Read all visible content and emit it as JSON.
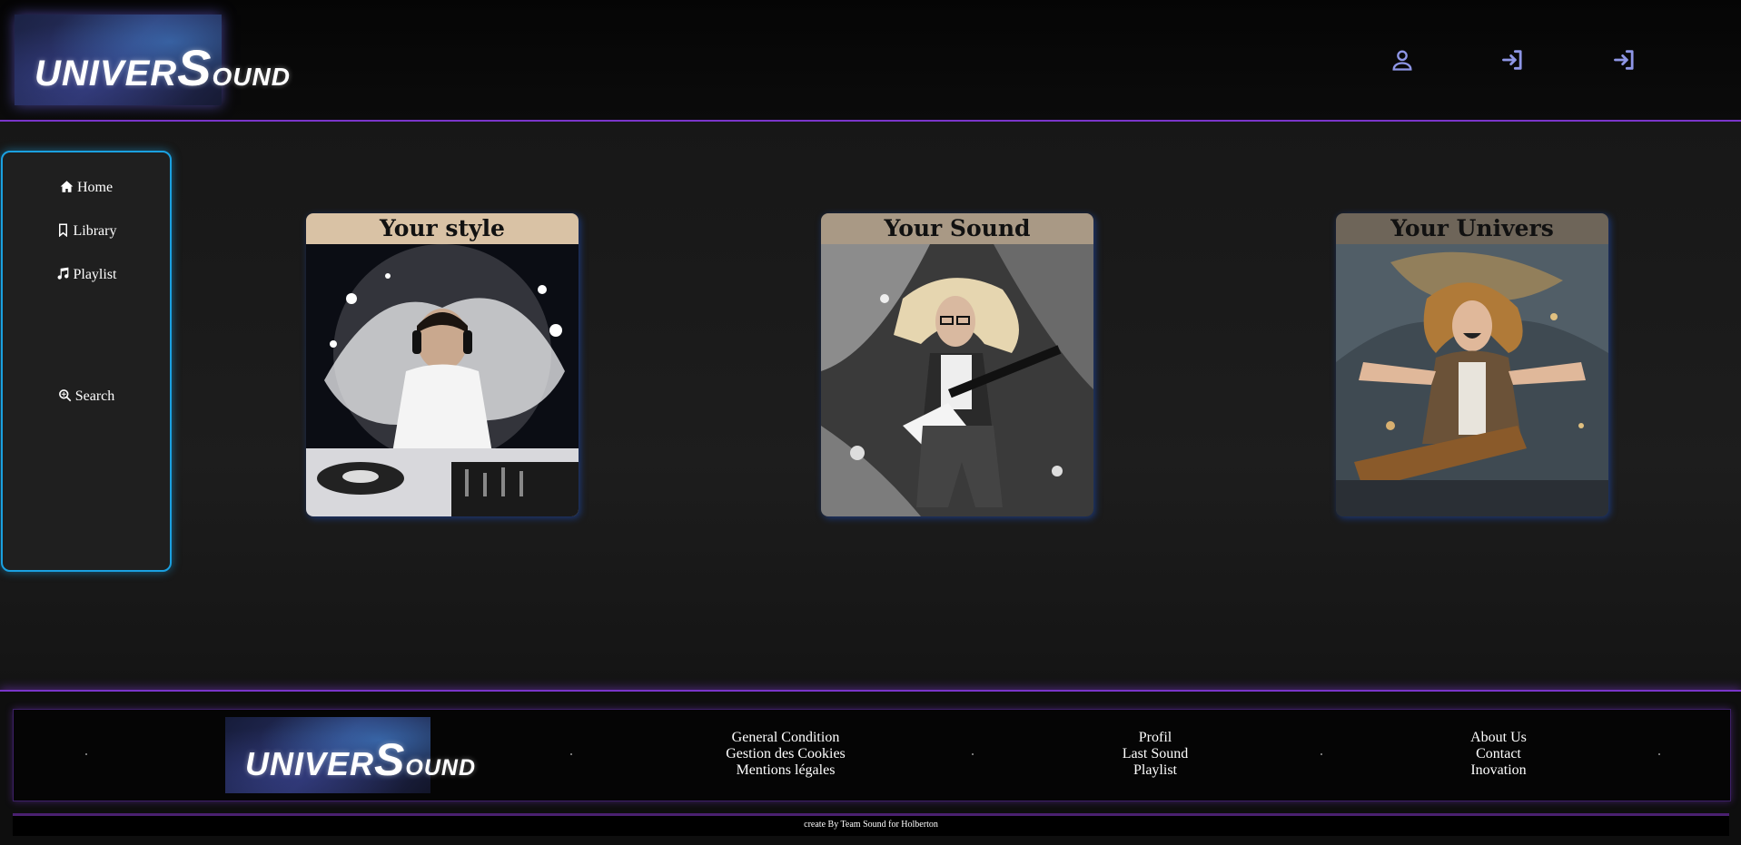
{
  "brand": {
    "logo_lead": "UNIVER",
    "logo_big": "S",
    "logo_tail": "OUND",
    "accent_purple": "#7a35c9",
    "accent_blue": "#1aa0e0",
    "icon_color": "#8e96e6"
  },
  "header": {
    "icons": [
      "user-icon",
      "sign-in-icon",
      "sign-in-icon"
    ]
  },
  "sidebar": {
    "items": [
      {
        "label": "Home",
        "icon": "home-icon"
      },
      {
        "label": "Library",
        "icon": "bookmark-icon"
      },
      {
        "label": "Playlist",
        "icon": "music-note-icon"
      },
      {
        "label": "Search",
        "icon": "search-icon"
      }
    ]
  },
  "cards": [
    {
      "title": "Your style",
      "title_bg": "#d9c2a5"
    },
    {
      "title": "Your Sound",
      "title_bg": "#a99985"
    },
    {
      "title": "Your Univers",
      "title_bg": "#6e6559"
    }
  ],
  "footer": {
    "col1": [
      "General Condition",
      "Gestion des Cookies",
      "Mentions légales"
    ],
    "col2": [
      "Profil",
      "Last Sound",
      "Playlist"
    ],
    "col3": [
      "About Us",
      "Contact",
      "Inovation"
    ],
    "credit": "create By Team Sound for Holberton"
  }
}
